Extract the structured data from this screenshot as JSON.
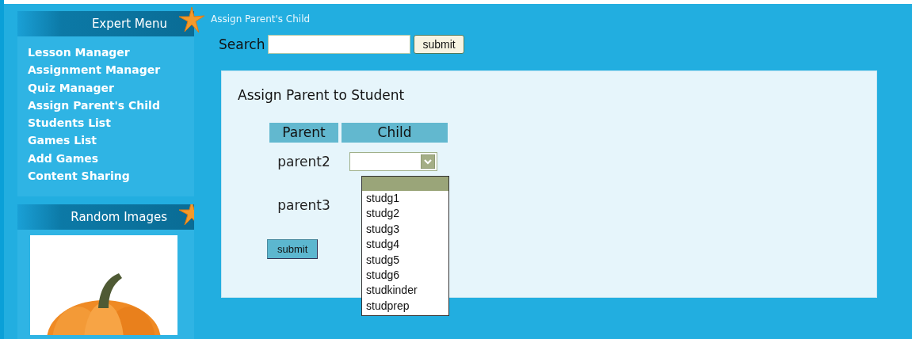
{
  "breadcrumb": "Assign Parent's Child",
  "search": {
    "label": "Search",
    "button": "submit"
  },
  "sidebar": {
    "menu_title": "Expert Menu",
    "items": [
      "Lesson Manager",
      "Assignment Manager",
      "Quiz Manager",
      "Assign Parent's Child",
      "Students List",
      "Games List",
      "Add Games",
      "Content Sharing"
    ],
    "images_title": "Random Images"
  },
  "form": {
    "title": "Assign Parent to Student",
    "columns": [
      "Parent",
      "Child"
    ],
    "rows": [
      {
        "parent": "parent2",
        "expanded": true
      },
      {
        "parent": "parent3",
        "expanded": false
      }
    ],
    "dropdown": {
      "blank_option": {
        "selected": true
      },
      "options": [
        {
          "label": "studg1",
          "selected": false
        },
        {
          "label": "studg2",
          "selected": false
        },
        {
          "label": "studg3",
          "selected": false
        },
        {
          "label": "studg4",
          "selected": false
        },
        {
          "label": "studg5",
          "selected": false
        },
        {
          "label": "studg6",
          "selected": false
        },
        {
          "label": "studkinder",
          "selected": false
        },
        {
          "label": "studprep",
          "selected": false
        }
      ]
    },
    "button": "submit"
  }
}
